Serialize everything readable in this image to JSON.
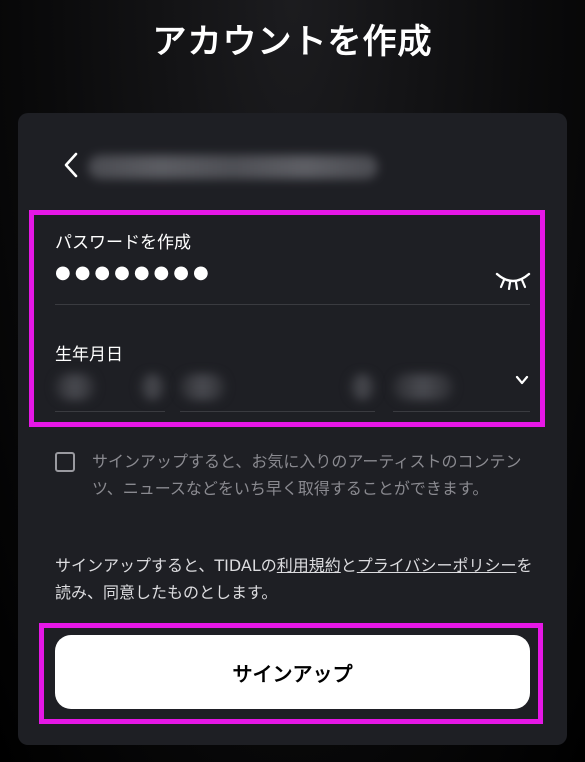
{
  "page": {
    "title": "アカウントを作成"
  },
  "header": {
    "back_icon": "chevron-left-icon"
  },
  "form": {
    "password": {
      "label": "パスワードを作成",
      "value": "●●●●●●●●",
      "toggle_icon": "eye-closed-icon"
    },
    "dob": {
      "label": "生年月日",
      "dropdown_icon": "chevron-down-icon"
    }
  },
  "consent": {
    "text": "サインアップすると、お気に入りのアーティストのコンテンツ、ニュースなどをいち早く取得することができます。"
  },
  "terms": {
    "prefix": "サインアップすると、TIDALの",
    "terms_link": "利用規約",
    "middle": "と",
    "privacy_link": "プライバシーポリシー",
    "suffix": "を読み、同意したものとします。"
  },
  "actions": {
    "signup_label": "サインアップ"
  },
  "colors": {
    "highlight": "#e617e6",
    "card": "#1e1f24",
    "button": "#ffffff"
  }
}
